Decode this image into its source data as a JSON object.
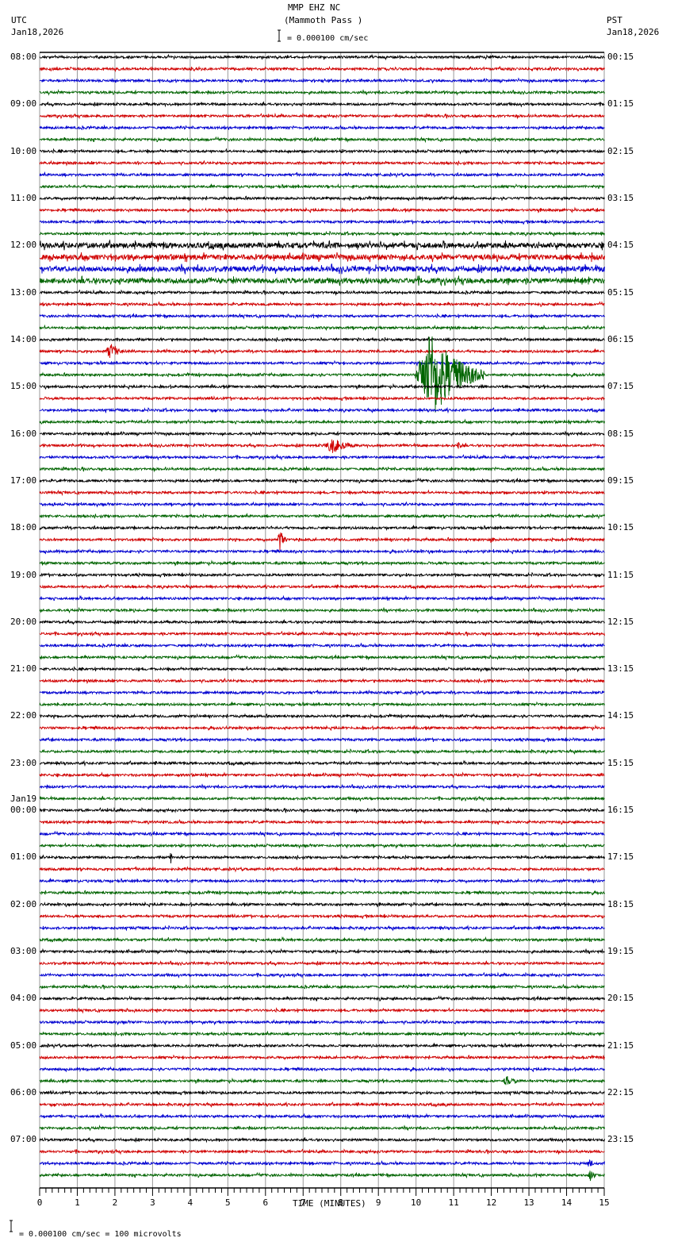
{
  "header": {
    "station": "MMP EHZ NC",
    "location": "(Mammoth Pass )",
    "scale": "= 0.000100 cm/sec",
    "left_tz": "UTC",
    "left_date": "Jan18,2026",
    "right_tz": "PST",
    "right_date": "Jan18,2026"
  },
  "footer": {
    "scale_note": "= 0.000100 cm/sec =     100 microvolts"
  },
  "chart_data": {
    "type": "line",
    "title": "MMP EHZ NC (Mammoth Pass )",
    "xlabel": "TIME (MINUTES)",
    "xlim": [
      0,
      15
    ],
    "x_ticks": [
      "0",
      "1",
      "2",
      "3",
      "4",
      "5",
      "6",
      "7",
      "8",
      "9",
      "10",
      "11",
      "12",
      "13",
      "14",
      "15"
    ],
    "traces_per_hour": 4,
    "trace_colors": [
      "#000000",
      "#d00000",
      "#0000d0",
      "#006400"
    ],
    "left_labels": [
      "08:00",
      "09:00",
      "10:00",
      "11:00",
      "12:00",
      "13:00",
      "14:00",
      "15:00",
      "16:00",
      "17:00",
      "18:00",
      "19:00",
      "20:00",
      "21:00",
      "22:00",
      "23:00",
      "00:00",
      "01:00",
      "02:00",
      "03:00",
      "04:00",
      "05:00",
      "06:00",
      "07:00"
    ],
    "left_date_change": {
      "hour_index": 16,
      "label": "Jan19"
    },
    "right_labels": [
      "00:15",
      "01:15",
      "02:15",
      "03:15",
      "04:15",
      "05:15",
      "06:15",
      "07:15",
      "08:15",
      "09:15",
      "10:15",
      "11:15",
      "12:15",
      "13:15",
      "14:15",
      "15:15",
      "16:15",
      "17:15",
      "18:15",
      "19:15",
      "20:15",
      "21:15",
      "22:15",
      "23:15"
    ],
    "noisy_traces": [
      16,
      17,
      18,
      19
    ],
    "events": [
      {
        "trace": 25,
        "start_min": 1.7,
        "end_min": 2.4,
        "amplitude": 10
      },
      {
        "trace": 27,
        "start_min": 9.95,
        "end_min": 11.8,
        "amplitude": 60
      },
      {
        "trace": 33,
        "start_min": 7.5,
        "end_min": 8.6,
        "amplitude": 10
      },
      {
        "trace": 33,
        "start_min": 11.0,
        "end_min": 11.5,
        "amplitude": 5
      },
      {
        "trace": 41,
        "start_min": 6.3,
        "end_min": 6.6,
        "amplitude": 18
      },
      {
        "trace": 41,
        "start_min": 11.95,
        "end_min": 12.15,
        "amplitude": 6
      },
      {
        "trace": 65,
        "start_min": 7.1,
        "end_min": 7.6,
        "amplitude": 3
      },
      {
        "trace": 68,
        "start_min": 3.45,
        "end_min": 3.55,
        "amplitude": 8
      },
      {
        "trace": 87,
        "start_min": 12.25,
        "end_min": 12.9,
        "amplitude": 7
      },
      {
        "trace": 94,
        "start_min": 14.55,
        "end_min": 14.75,
        "amplitude": 10
      },
      {
        "trace": 95,
        "start_min": 14.55,
        "end_min": 14.8,
        "amplitude": 12
      }
    ]
  }
}
